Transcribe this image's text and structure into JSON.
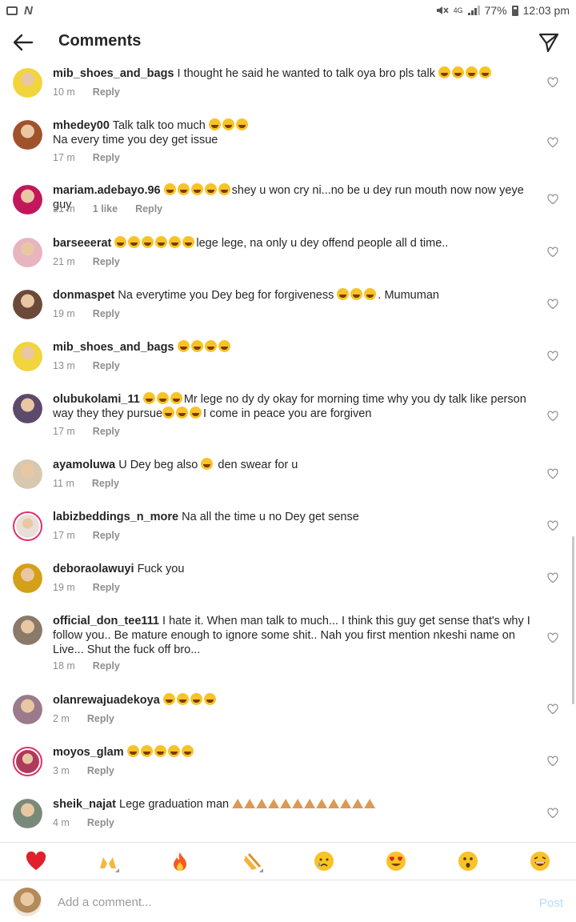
{
  "status_bar": {
    "battery": "77%",
    "time": "12:03 pm",
    "network": "4G"
  },
  "header": {
    "title": "Comments"
  },
  "comments": [
    {
      "username": "mib_shoes_and_bags",
      "text": "I thought he said he wanted to talk oya bro pls talk",
      "emoji_count": 4,
      "time": "10 m",
      "likes": "",
      "reply": "Reply",
      "avatar_color": "#f2d43c"
    },
    {
      "username": "mhedey00",
      "text": "Talk talk too much",
      "emoji_count": 3,
      "text2": "Na every time you dey get issue",
      "time": "17 m",
      "likes": "",
      "reply": "Reply",
      "avatar_color": "#a0522d"
    },
    {
      "username": "mariam.adebayo.96",
      "text_before_emoji": "",
      "emoji_count": 5,
      "text": "shey u won cry ni...no be u dey run mouth now now yeye guy",
      "time": "21 m",
      "likes": "1 like",
      "reply": "Reply",
      "avatar_color": "#c2185b"
    },
    {
      "username": "barseeerat",
      "emoji_count": 6,
      "text": "lege lege, na only u dey offend people all d time..",
      "time": "21 m",
      "likes": "",
      "reply": "Reply",
      "avatar_color": "#e8b4c0"
    },
    {
      "username": "donmaspet",
      "text": "Na everytime you Dey beg for forgiveness",
      "emoji_count": 3,
      "text_after": ". Mumuman",
      "time": "19 m",
      "likes": "",
      "reply": "Reply",
      "avatar_color": "#6b4a3a"
    },
    {
      "username": "mib_shoes_and_bags",
      "text": "",
      "emoji_count": 4,
      "time": "13 m",
      "likes": "",
      "reply": "Reply",
      "avatar_color": "#f2d43c"
    },
    {
      "username": "olubukolami_11",
      "emoji_count": 3,
      "text": "Mr lege no dy dy okay for morning time why you dy talk like person way they they pursue",
      "emoji_count2": 3,
      "text_after": "I come in peace you are forgiven",
      "time": "17 m",
      "likes": "",
      "reply": "Reply",
      "avatar_color": "#5d4a6b"
    },
    {
      "username": "ayamoluwa",
      "text": "U Dey beg also",
      "emoji_count": 1,
      "text_after": " den swear for u",
      "time": "11 m",
      "likes": "",
      "reply": "Reply",
      "avatar_color": "#d8c8b0"
    },
    {
      "username": "labizbeddings_n_more",
      "text": "Na all the time u no Dey get sense",
      "time": "17 m",
      "likes": "",
      "reply": "Reply",
      "avatar_color": "#e8e0d8"
    },
    {
      "username": "deboraolawuyi",
      "text": "Fuck you",
      "time": "19 m",
      "likes": "",
      "reply": "Reply",
      "avatar_color": "#d4a017"
    },
    {
      "username": "official_don_tee111",
      "text": "I hate it. When man talk to much... I think this guy get sense that's why I follow you.. Be mature enough to ignore some shit.. Nah you first mention nkeshi name on Live... Shut the fuck off bro...",
      "time": "18 m",
      "likes": "",
      "reply": "Reply",
      "avatar_color": "#8a7a6a"
    },
    {
      "username": "olanrewajuadekoya",
      "text": "",
      "emoji_count": 4,
      "time": "2 m",
      "likes": "",
      "reply": "Reply",
      "avatar_color": "#9b7b8b"
    },
    {
      "username": "moyos_glam",
      "text": "",
      "emoji_count": 5,
      "time": "3 m",
      "likes": "",
      "reply": "Reply",
      "avatar_color": "#b03a5b"
    },
    {
      "username": "sheik_najat",
      "text": "Lege graduation man",
      "pray_count": 12,
      "time": "4 m",
      "likes": "",
      "reply": "Reply",
      "avatar_color": "#7a8a7a"
    }
  ],
  "emoji_bar": [
    "heart",
    "raising-hands",
    "fire",
    "clapping-hands",
    "crying-face",
    "heart-eyes-face",
    "surprised-face",
    "laughing-face"
  ],
  "add_comment": {
    "placeholder": "Add a comment...",
    "post_label": "Post"
  }
}
